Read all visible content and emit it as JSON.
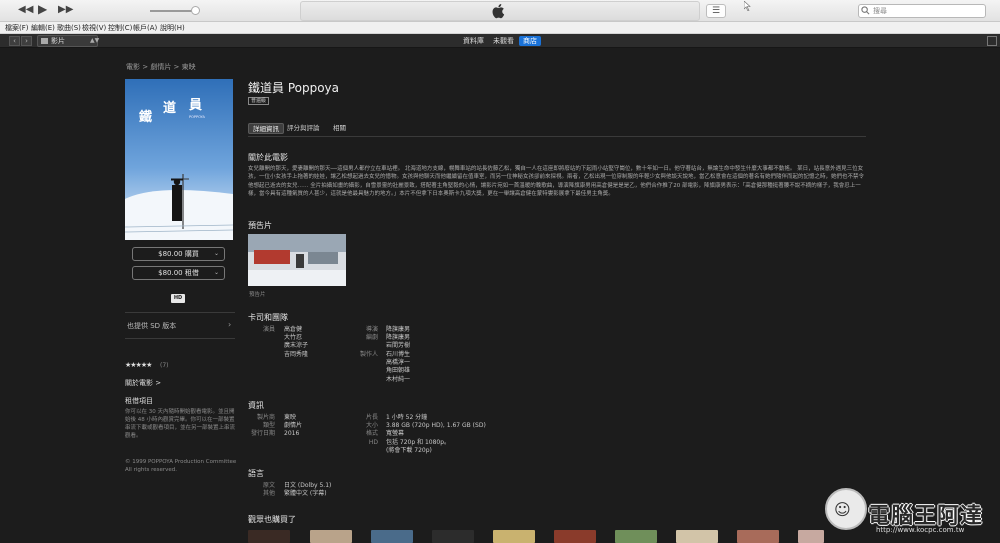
{
  "window": {
    "search_placeholder": "搜尋"
  },
  "menu": [
    "檔案(F)",
    "編輯(E)",
    "歌曲(S)",
    "檢視(V)",
    "控制(C)",
    "帳戶(A)",
    "說明(H)"
  ],
  "nav": {
    "back": "‹",
    "forward": "›",
    "media_kind": "影片",
    "tabs": [
      {
        "label": "資料庫",
        "active": false
      },
      {
        "label": "未觀看",
        "active": false
      },
      {
        "label": "商店",
        "active": true
      }
    ]
  },
  "breadcrumb": "電影 > 劇情片 > 東映",
  "movie": {
    "title": "鐵道員 Poppoya",
    "genre_badge": "普遍級",
    "poster_title": "鐵道員",
    "poster_subtitle": "POPPOYA",
    "buy_label": "$80.00 購買",
    "rent_label": "$80.00 租借",
    "hd_badge": "HD",
    "sd_link": "也提供 SD 版本",
    "stars": "★★★★★",
    "rating_count": "(7)",
    "about_link": "關於電影 >",
    "rent_title": "租借項目",
    "rent_text": "你可以在 30 天內隨時開始觀看電影。並且開始後 48 小時內觀賞完畢。你可以在一部裝置串流下載或觀看項目，並在另一部裝置上串流觀看。",
    "copyright": "© 1999 POPPOYA Production Committee All rights reserved."
  },
  "tabs": [
    {
      "label": "詳細資訊",
      "active": true
    },
    {
      "label": "評分與評論",
      "active": false
    },
    {
      "label": "相關",
      "active": false
    }
  ],
  "about": {
    "heading": "關於此電影",
    "text": "女兒離開的那天，愛妻離開的那天──這個男人都佇立在車站裡。 北海道地方支線，幌舞車站的站長佐藤乙松，獨自一人在這座即將廢站的下起雨小站堅守崗位，數十年如一日。他守著站台，無論生命中發生什麼大事都不動搖。 某日，站長意外遇見三位女孩，一位小女孩手上拖著的娃娃，讓乙松想起過去女兒的憶物。女孩與他聊天而他繼續留在值車室，而另一位神秘女孩卻前來探視。兩者，乙松出現一位穿制服的年輕少女與他談天說地，當乙松意會在這個的著名有她們隨伴而起的記憶之時，她們也不禁令他想起已逝去的女兒…… 全片拍攝如畫的攝影，自雪景靈的壯麗景致，搭配著主角堅毅的心情，讓影片宛如一首溫暖的輓歌曲，導演降旗康男用高倉健是是是乙，他們合作推了20 部電影，降旗康男表示：「高倉健那種挺著腰不說不摘的樣子，我會忍上一樣，當今具有這種氣質的人甚少，這就是他最具魅力的地方。」本片不但拿下日本奧斯卡九項大獎，更在一舉讓高倉健在蒙特婁影展拿下最佳男主角獎。"
  },
  "trailer": {
    "heading": "預告片",
    "label": "預告片"
  },
  "cast": {
    "heading": "卡司和團隊",
    "groups": [
      {
        "role": "演員",
        "names": [
          "高倉健",
          "大竹忍",
          "廣末涼子",
          "吉岡秀隆"
        ]
      },
      {
        "role": "導演",
        "names": [
          "降旗康男"
        ]
      },
      {
        "role": "編劇",
        "names": [
          "降旗康男",
          "岩間芳樹"
        ]
      },
      {
        "role": "製作人",
        "names": [
          "石川博生",
          "高橋淳一",
          "角田朝雄",
          "木村純一"
        ]
      }
    ]
  },
  "info": {
    "heading": "資訊",
    "left": [
      {
        "k": "製片商",
        "v": "東映"
      },
      {
        "k": "類型",
        "v": "劇情片"
      },
      {
        "k": "發行日期",
        "v": "2016"
      }
    ],
    "right": [
      {
        "k": "片長",
        "v": "1 小時 52 分鐘"
      },
      {
        "k": "大小",
        "v": "3.88 GB (720p HD), 1.67 GB (SD)"
      },
      {
        "k": "格式",
        "v": "寬螢幕"
      },
      {
        "k": "HD",
        "v": "包括 720p 和 1080p。"
      },
      {
        "k": "",
        "v": "(將會下載 720p)"
      }
    ]
  },
  "languages": {
    "heading": "語言",
    "rows": [
      {
        "k": "原文",
        "v": "日文 (Dolby 5.1)"
      },
      {
        "k": "其他",
        "v": "繁體中文 (字幕)"
      }
    ]
  },
  "also_bought": {
    "heading": "觀眾也購買了"
  },
  "watermark": {
    "brand": "電腦王阿達",
    "url": "http://www.kocpc.com.tw"
  }
}
